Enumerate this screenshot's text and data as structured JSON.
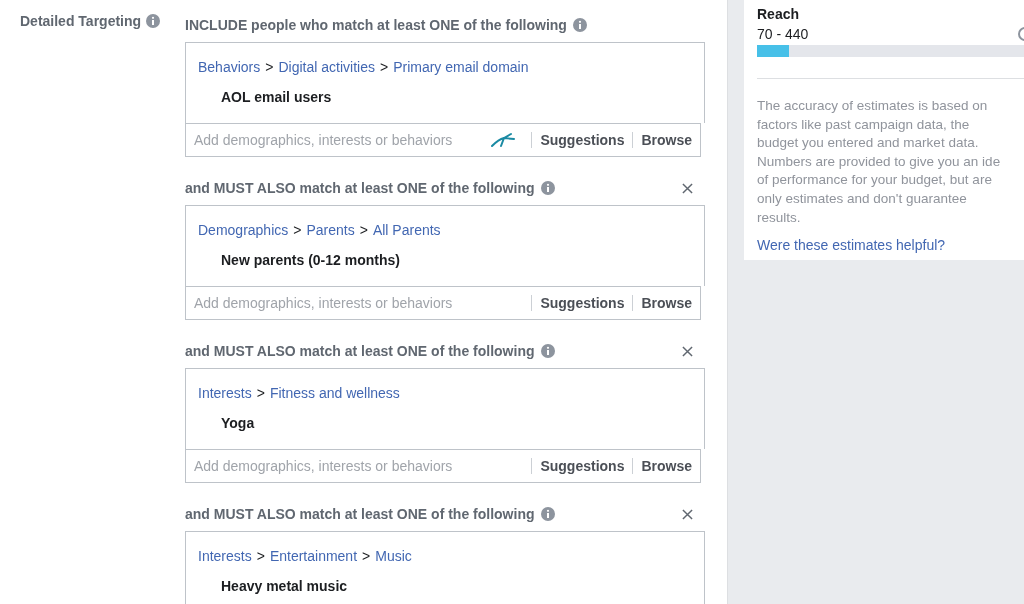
{
  "section_label": "Detailed Targeting",
  "groups": [
    {
      "heading": "INCLUDE people who match at least ONE of the following",
      "removable": false,
      "path": [
        {
          "kind": "link",
          "text": "Behaviors"
        },
        {
          "kind": "separator",
          "text": ">"
        },
        {
          "kind": "link",
          "text": "Digital activities"
        },
        {
          "kind": "separator",
          "text": ">"
        },
        {
          "kind": "link",
          "text": "Primary email domain"
        }
      ],
      "item": "AOL email users",
      "input": {
        "placeholder": "Add demographics, interests or behaviors",
        "assist_icon": true,
        "actions": [
          "Suggestions",
          "Browse"
        ]
      }
    },
    {
      "heading": "and MUST ALSO match at least ONE of the following",
      "removable": true,
      "path": [
        {
          "kind": "link",
          "text": "Demographics"
        },
        {
          "kind": "separator",
          "text": ">"
        },
        {
          "kind": "link",
          "text": "Parents"
        },
        {
          "kind": "separator",
          "text": ">"
        },
        {
          "kind": "link",
          "text": "All Parents"
        }
      ],
      "item": "New parents (0-12 months)",
      "input": {
        "placeholder": "Add demographics, interests or behaviors",
        "assist_icon": false,
        "actions": [
          "Suggestions",
          "Browse"
        ]
      }
    },
    {
      "heading": "and MUST ALSO match at least ONE of the following",
      "removable": true,
      "path": [
        {
          "kind": "link",
          "text": "Interests"
        },
        {
          "kind": "separator",
          "text": ">"
        },
        {
          "kind": "link",
          "text": "Fitness and wellness"
        }
      ],
      "item": "Yoga",
      "input": {
        "placeholder": "Add demographics, interests or behaviors",
        "assist_icon": false,
        "actions": [
          "Suggestions",
          "Browse"
        ]
      }
    },
    {
      "heading": "and MUST ALSO match at least ONE of the following",
      "removable": true,
      "path": [
        {
          "kind": "link",
          "text": "Interests"
        },
        {
          "kind": "separator",
          "text": ">"
        },
        {
          "kind": "link",
          "text": "Entertainment"
        },
        {
          "kind": "separator",
          "text": ">"
        },
        {
          "kind": "link",
          "text": "Music"
        }
      ],
      "item": "Heavy metal music"
    }
  ],
  "estimate": {
    "metric": "Reach",
    "range": "70 - 440",
    "level": 0.12,
    "note_lines": [
      "The accuracy of estimates is based on",
      "factors like past campaign data, the",
      "budget you entered and market data.",
      "Numbers are provided to give you an ide",
      "of performance for your budget, but are",
      "only estimates and don't guarantee",
      "results."
    ],
    "feedback_link": "Were these estimates helpful?"
  }
}
